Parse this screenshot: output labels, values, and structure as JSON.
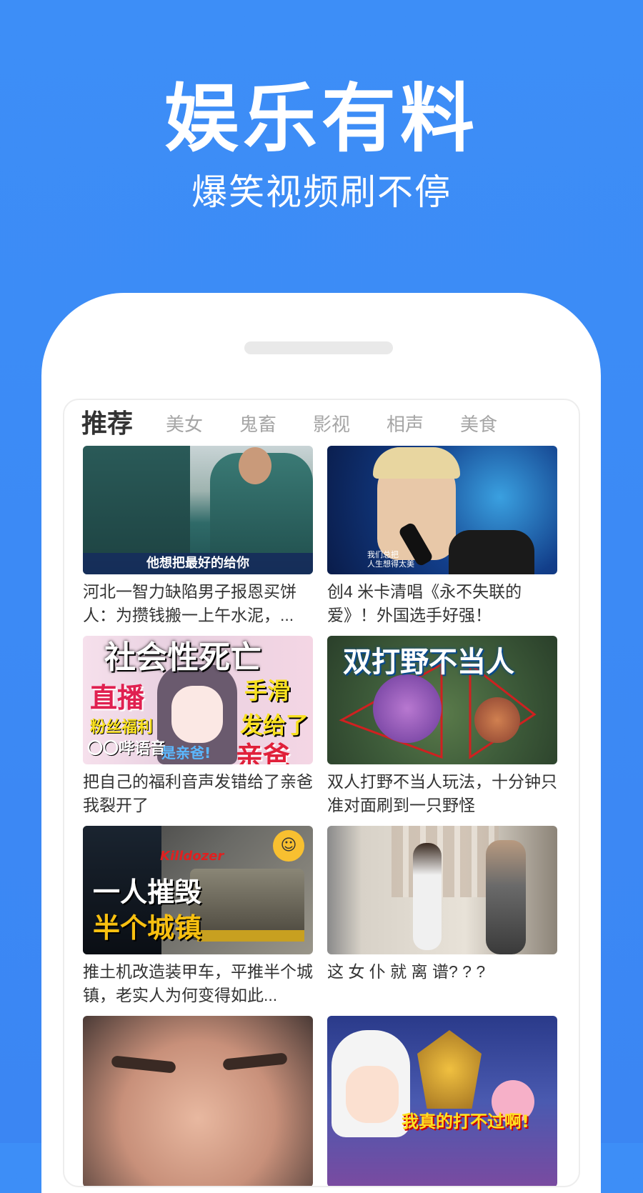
{
  "promo": {
    "headline": "娱乐有料",
    "subline": "爆笑视频刷不停"
  },
  "tabs": [
    "推荐",
    "美女",
    "鬼畜",
    "影视",
    "相声",
    "美食"
  ],
  "active_tab": "推荐",
  "feed": [
    {
      "title": "河北一智力缺陷男子报恩买饼人：为攒钱搬一上午水泥，...",
      "caption": "他想把最好的给你"
    },
    {
      "title": "创4 米卡清唱《永不失联的爱》！外国选手好强！",
      "subtitle_lines": [
        "我们总把",
        "人生想得太美"
      ]
    },
    {
      "title": "把自己的福利音声发错给了亲爸 我裂开了",
      "overlay": [
        "社会性死亡",
        "直播",
        "粉丝福利",
        "〇〇哔语音",
        "手滑",
        "发给了",
        "亲爸",
        "是亲爸!"
      ]
    },
    {
      "title": "双人打野不当人玩法，十分钟只准对面刷到一只野怪",
      "overlay": [
        "双打野不当人"
      ]
    },
    {
      "title": "推土机改造装甲车，平推半个城镇，老实人为何变得如此...",
      "overlay": [
        "一人摧毁",
        "半个城镇",
        "Killdozer"
      ]
    },
    {
      "title": "这 女 仆 就 离 谱? ? ?"
    },
    {
      "title": ""
    },
    {
      "title": "",
      "overlay": [
        "我真的打不过啊!"
      ]
    }
  ],
  "colors": {
    "background": "#3d8ef7",
    "text_primary": "#333333",
    "tab_inactive": "#a6a6a6"
  }
}
